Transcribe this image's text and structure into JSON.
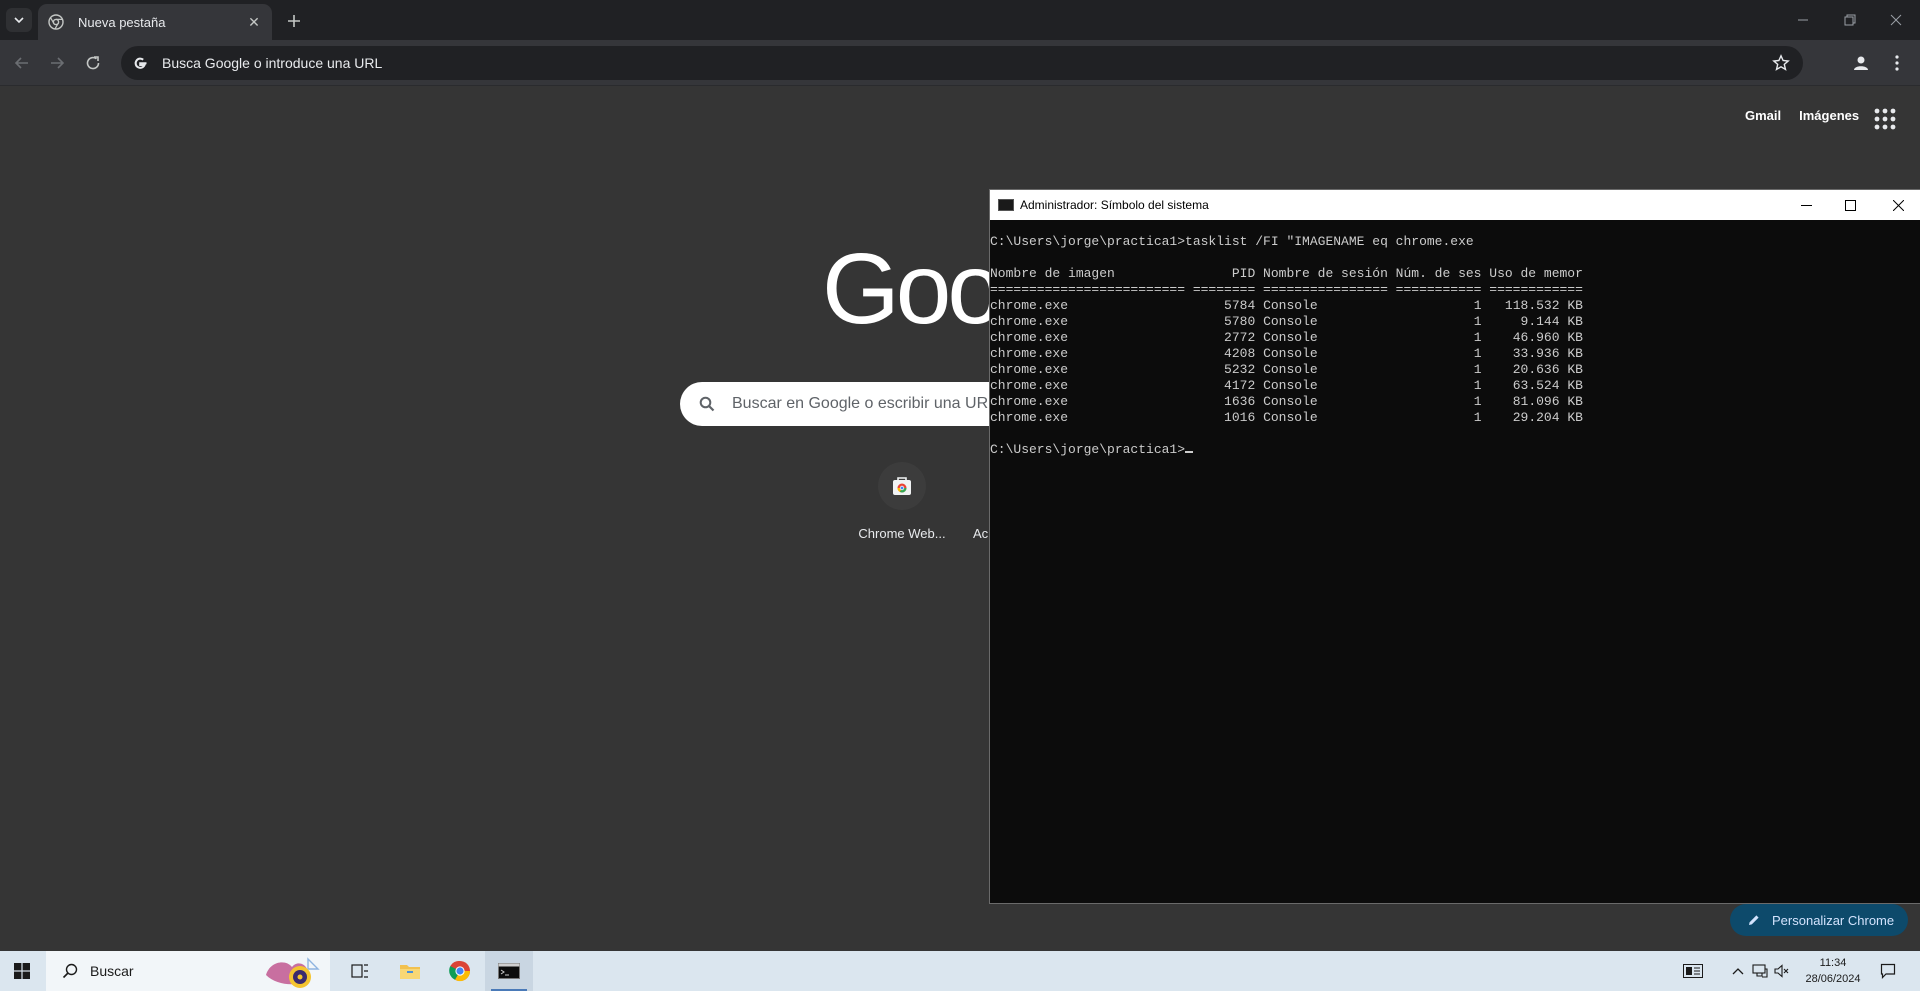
{
  "browser": {
    "tab": {
      "title": "Nueva pestaña"
    },
    "omnibox": {
      "placeholder": "Busca Google o introduce una URL"
    }
  },
  "ntp": {
    "links": {
      "gmail": "Gmail",
      "images": "Imágenes"
    },
    "logo_visible_text": "Goo",
    "search_placeholder": "Buscar en Google o escribir una URL",
    "shortcuts": [
      {
        "label": "Chrome Web..."
      },
      {
        "label": "Ac"
      }
    ],
    "customize_label": "Personalizar Chrome"
  },
  "cmd": {
    "title": "Administrador: Símbolo del sistema",
    "command_line": "C:\\Users\\jorge\\practica1>tasklist /FI \"IMAGENAME eq chrome.exe",
    "header_line": "Nombre de imagen               PID Nombre de sesión Núm. de ses Uso de memor",
    "separator_line": "========================= ======== ================ =========== ============",
    "rows": [
      {
        "image": "chrome.exe",
        "pid": "5784",
        "session": "Console",
        "num": "1",
        "mem": "118.532 KB"
      },
      {
        "image": "chrome.exe",
        "pid": "5780",
        "session": "Console",
        "num": "1",
        "mem": "9.144 KB"
      },
      {
        "image": "chrome.exe",
        "pid": "2772",
        "session": "Console",
        "num": "1",
        "mem": "46.960 KB"
      },
      {
        "image": "chrome.exe",
        "pid": "4208",
        "session": "Console",
        "num": "1",
        "mem": "33.936 KB"
      },
      {
        "image": "chrome.exe",
        "pid": "5232",
        "session": "Console",
        "num": "1",
        "mem": "20.636 KB"
      },
      {
        "image": "chrome.exe",
        "pid": "4172",
        "session": "Console",
        "num": "1",
        "mem": "63.524 KB"
      },
      {
        "image": "chrome.exe",
        "pid": "1636",
        "session": "Console",
        "num": "1",
        "mem": "81.096 KB"
      },
      {
        "image": "chrome.exe",
        "pid": "1016",
        "session": "Console",
        "num": "1",
        "mem": "29.204 KB"
      }
    ],
    "prompt": "C:\\Users\\jorge\\practica1>"
  },
  "taskbar": {
    "search_label": "Buscar",
    "time": "11:34",
    "date": "28/06/2024",
    "apps": [
      "task-view-icon",
      "file-explorer-icon",
      "chrome-icon",
      "cmd-icon"
    ]
  },
  "colors": {
    "ntp_background": "#353535",
    "tabstrip": "#202124",
    "toolbar": "#35363a",
    "cmd_background": "#0c0c0c",
    "cmd_text": "#cccccc",
    "taskbar": "#dbe6ef",
    "customize_button": "#0d4a6b"
  }
}
